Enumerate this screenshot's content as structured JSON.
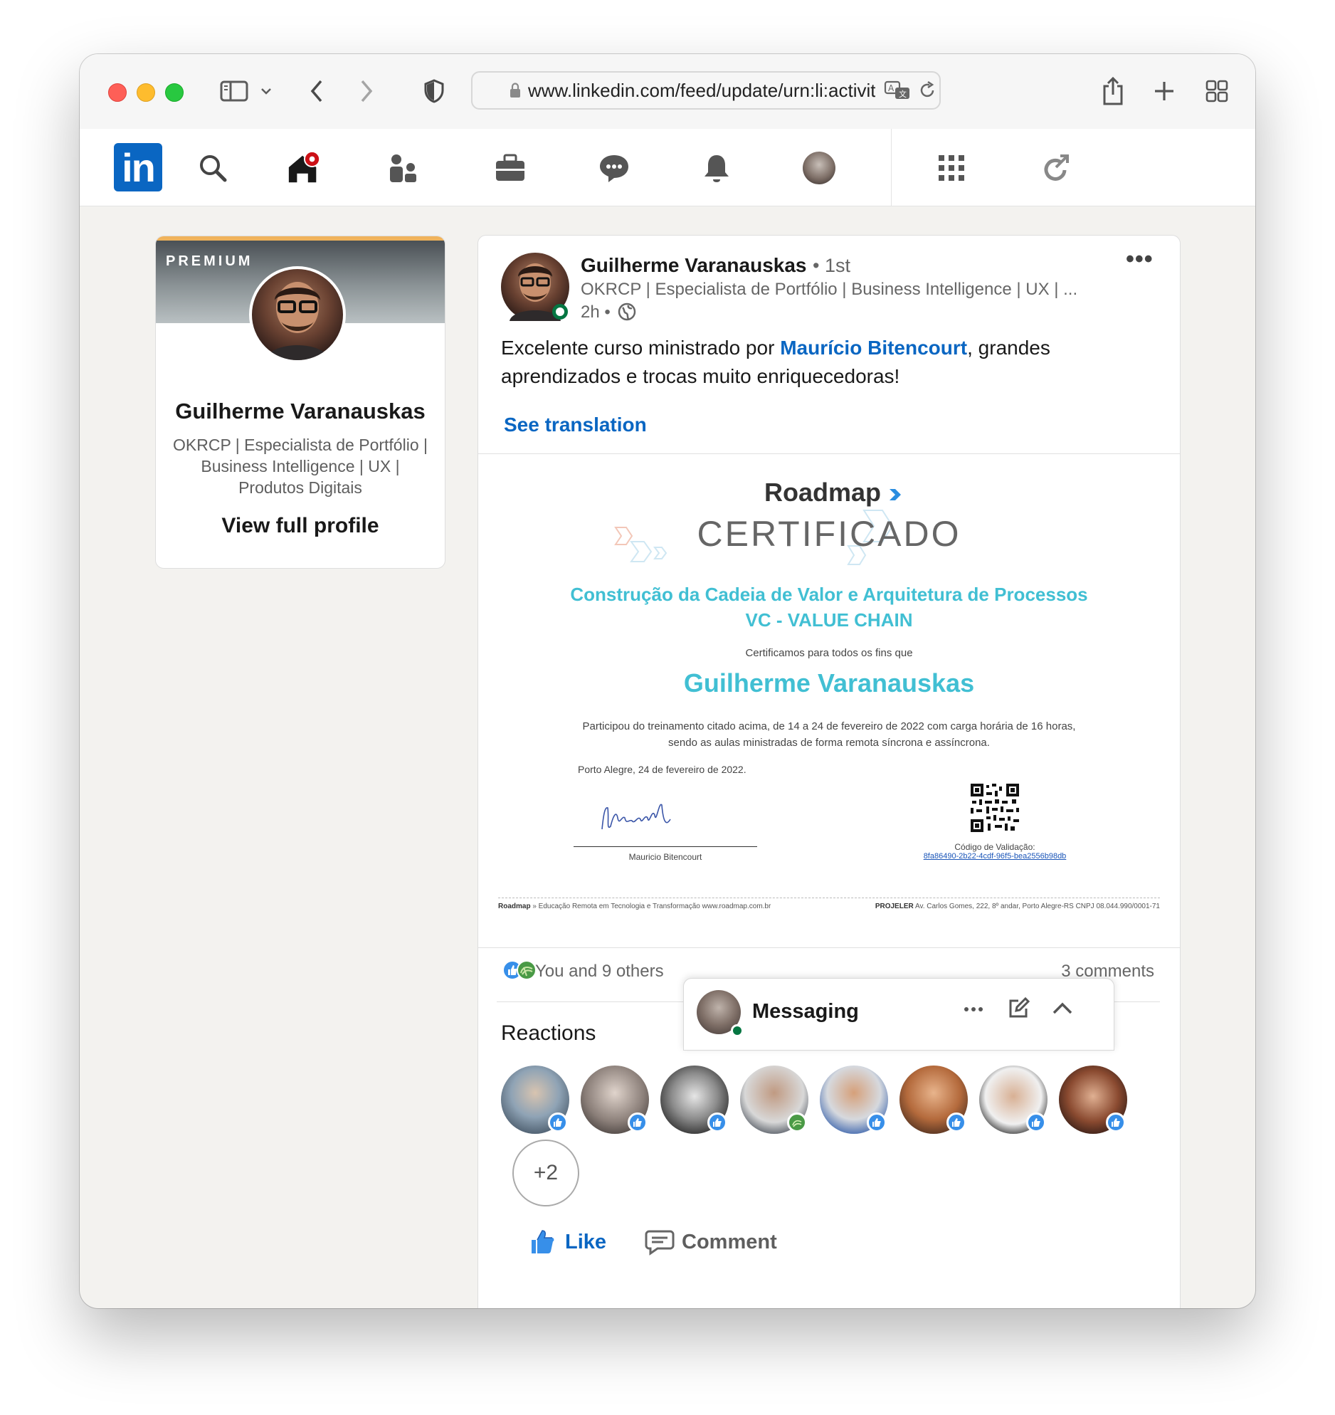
{
  "browser": {
    "url": "www.linkedin.com/feed/update/urn:li:activity"
  },
  "nav": {
    "logo_text": "in",
    "items": [
      "search-icon",
      "home-icon",
      "my-network-icon",
      "jobs-icon",
      "messaging-icon",
      "notifications-icon",
      "me-avatar",
      "work-grid-icon",
      "premium-icon"
    ],
    "home_badge_color": "#cc1016"
  },
  "profile_card": {
    "badge": "PREMIUM",
    "name": "Guilherme Varanauskas",
    "headline": "OKRCP | Especialista de Portfólio | Business Intelligence | UX | Produtos Digitais",
    "view_label": "View full profile"
  },
  "post": {
    "author": {
      "name": "Guilherme Varanauskas",
      "degree": "• 1st",
      "headline": "OKRCP | Especialista de Portfólio | Business Intelligence | UX | ...",
      "time": "2h •"
    },
    "text_before": "Excelente curso ministrado por ",
    "mention": "Maurício Bitencourt",
    "text_after": ", grandes aprendizados e trocas muito enriquecedoras!",
    "see_translation": "See translation",
    "certificate": {
      "brand": "Roadmap",
      "heading": "CERTIFICADO",
      "course_line1": "Construção da Cadeia de Valor e Arquitetura de Processos",
      "course_line2": "VC - VALUE CHAIN",
      "certify_text": "Certificamos para todos os fins que",
      "recipient": "Guilherme Varanauskas",
      "description": "Participou do treinamento citado acima, de 14 a 24 de fevereiro de 2022 com carga horária de 16 horas, sendo as aulas ministradas de forma remota síncrona e assíncrona.",
      "place_date": "Porto Alegre, 24 de fevereiro de 2022.",
      "signer": "Mauricio Bitencourt",
      "validation_label": "Código de Validação:",
      "validation_code": "8fa86490-2b22-4cdf-96f5-bea2556b98db",
      "footer_left_brand": "Roadmap",
      "footer_left": "» Educação Remota em Tecnologia e Transformação www.roadmap.com.br",
      "footer_right_brand": "PROJELER",
      "footer_right": "Av. Carlos Gomes, 222, 8º andar, Porto Alegre-RS  CNPJ 08.044.990/0001-71"
    },
    "social": {
      "reactions_text": "You and 9 others",
      "comments_text": "3 comments"
    },
    "reactions_title": "Reactions",
    "reactors": [
      {
        "reaction": "like-icon"
      },
      {
        "reaction": "like-icon"
      },
      {
        "reaction": "like-icon"
      },
      {
        "reaction": "support-icon"
      },
      {
        "reaction": "like-icon"
      },
      {
        "reaction": "like-icon"
      },
      {
        "reaction": "like-icon"
      },
      {
        "reaction": "like-icon"
      }
    ],
    "more_reactors": "+2",
    "actions": {
      "like": "Like",
      "comment": "Comment"
    }
  },
  "messaging": {
    "label": "Messaging"
  },
  "colors": {
    "linkedin_blue": "#0a66c2",
    "cert_teal": "#41bfd3",
    "online_green": "#057642"
  }
}
